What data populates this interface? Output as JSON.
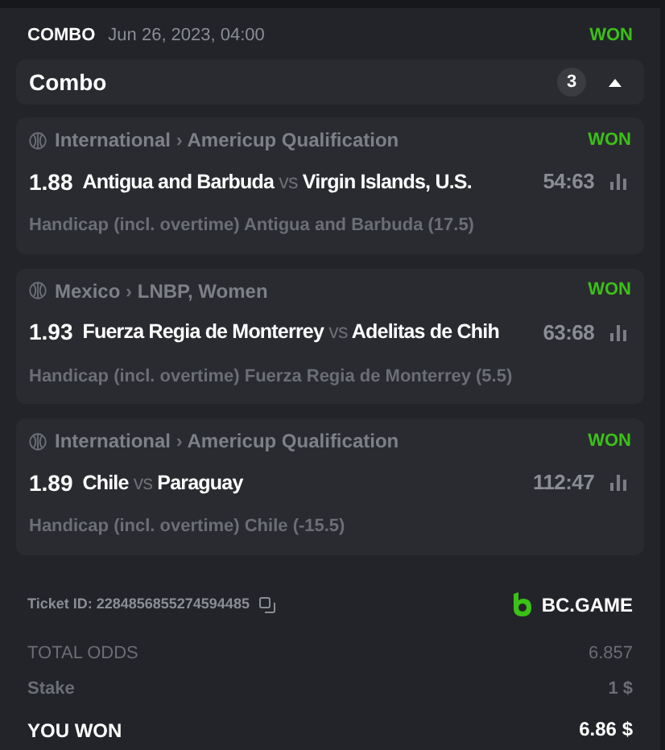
{
  "header": {
    "type": "COMBO",
    "date": "Jun 26, 2023, 04:00",
    "status": "WON"
  },
  "combo": {
    "title": "Combo",
    "count": "3",
    "expanded": true
  },
  "bets": [
    {
      "country": "International",
      "sep": "›",
      "league": "Americup Qualification",
      "status": "WON",
      "odds": "1.88",
      "home": "Antigua and Barbuda",
      "vs": "vs",
      "away": "Virgin Islands, U.S.",
      "score": "54:63",
      "market": "Handicap (incl. overtime) Antigua and Barbuda (17.5)"
    },
    {
      "country": "Mexico",
      "sep": "›",
      "league": "LNBP, Women",
      "status": "WON",
      "odds": "1.93",
      "home": "Fuerza Regia de Monterrey",
      "vs": "vs",
      "away": "Adelitas de Chih",
      "score": "63:68",
      "market": "Handicap (incl. overtime) Fuerza Regia de Monterrey (5.5)"
    },
    {
      "country": "International",
      "sep": "›",
      "league": "Americup Qualification",
      "status": "WON",
      "odds": "1.89",
      "home": "Chile",
      "vs": "vs",
      "away": "Paraguay",
      "score": "112:47",
      "market": "Handicap (incl. overtime) Chile (-15.5)"
    }
  ],
  "ticket": {
    "label": "Ticket ID: 2284856855274594485",
    "brand": "BC.GAME"
  },
  "totals": [
    {
      "label": "TOTAL ODDS",
      "value": "6.857",
      "kind": "plain"
    },
    {
      "label": "Stake",
      "value": "1 $",
      "kind": "plain"
    },
    {
      "label": "YOU WON",
      "value": "6.86 $",
      "kind": "strong"
    }
  ]
}
